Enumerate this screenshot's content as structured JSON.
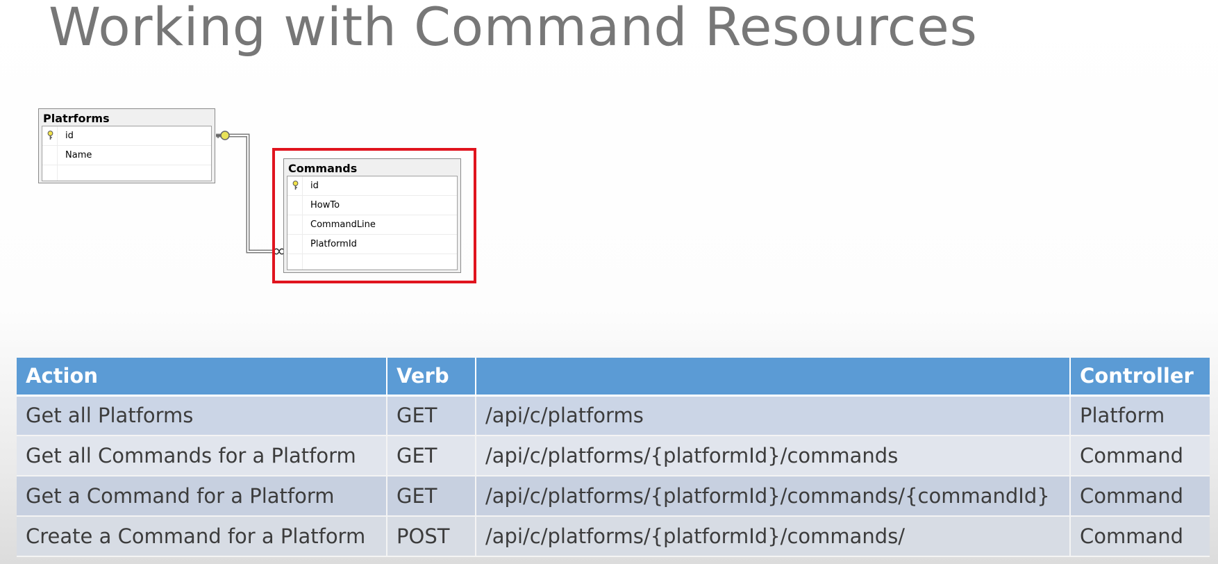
{
  "title": "Working with Command Resources",
  "diagram": {
    "platforms": {
      "name": "Platrforms",
      "columns": [
        {
          "name": "id",
          "key": true
        },
        {
          "name": "Name",
          "key": false
        }
      ]
    },
    "commands": {
      "name": "Commands",
      "columns": [
        {
          "name": "id",
          "key": true
        },
        {
          "name": "HowTo",
          "key": false
        },
        {
          "name": "CommandLine",
          "key": false
        },
        {
          "name": "PlatformId",
          "key": false
        }
      ],
      "highlight_color": "#e0141e"
    },
    "relationship": {
      "from": "Platrforms.id",
      "to": "Commands.PlatformId",
      "from_symbol": "key-icon",
      "to_symbol": "infinity-icon"
    }
  },
  "routes": {
    "headers": [
      "Action",
      "Verb",
      "",
      "Controller"
    ],
    "rows": [
      {
        "action": "Get all Platforms",
        "verb": "GET",
        "uri": "/api/c/platforms",
        "controller": "Platform"
      },
      {
        "action": "Get all Commands for a Platform",
        "verb": "GET",
        "uri": "/api/c/platforms/{platformId}/commands",
        "controller": "Command"
      },
      {
        "action": "Get a Command for a Platform",
        "verb": "GET",
        "uri": "/api/c/platforms/{platformId}/commands/{commandId}",
        "controller": "Command"
      },
      {
        "action": "Create a Command for a Platform",
        "verb": "POST",
        "uri": "/api/c/platforms/{platformId}/commands/",
        "controller": "Command"
      }
    ],
    "header_color": "#5b9bd5"
  }
}
